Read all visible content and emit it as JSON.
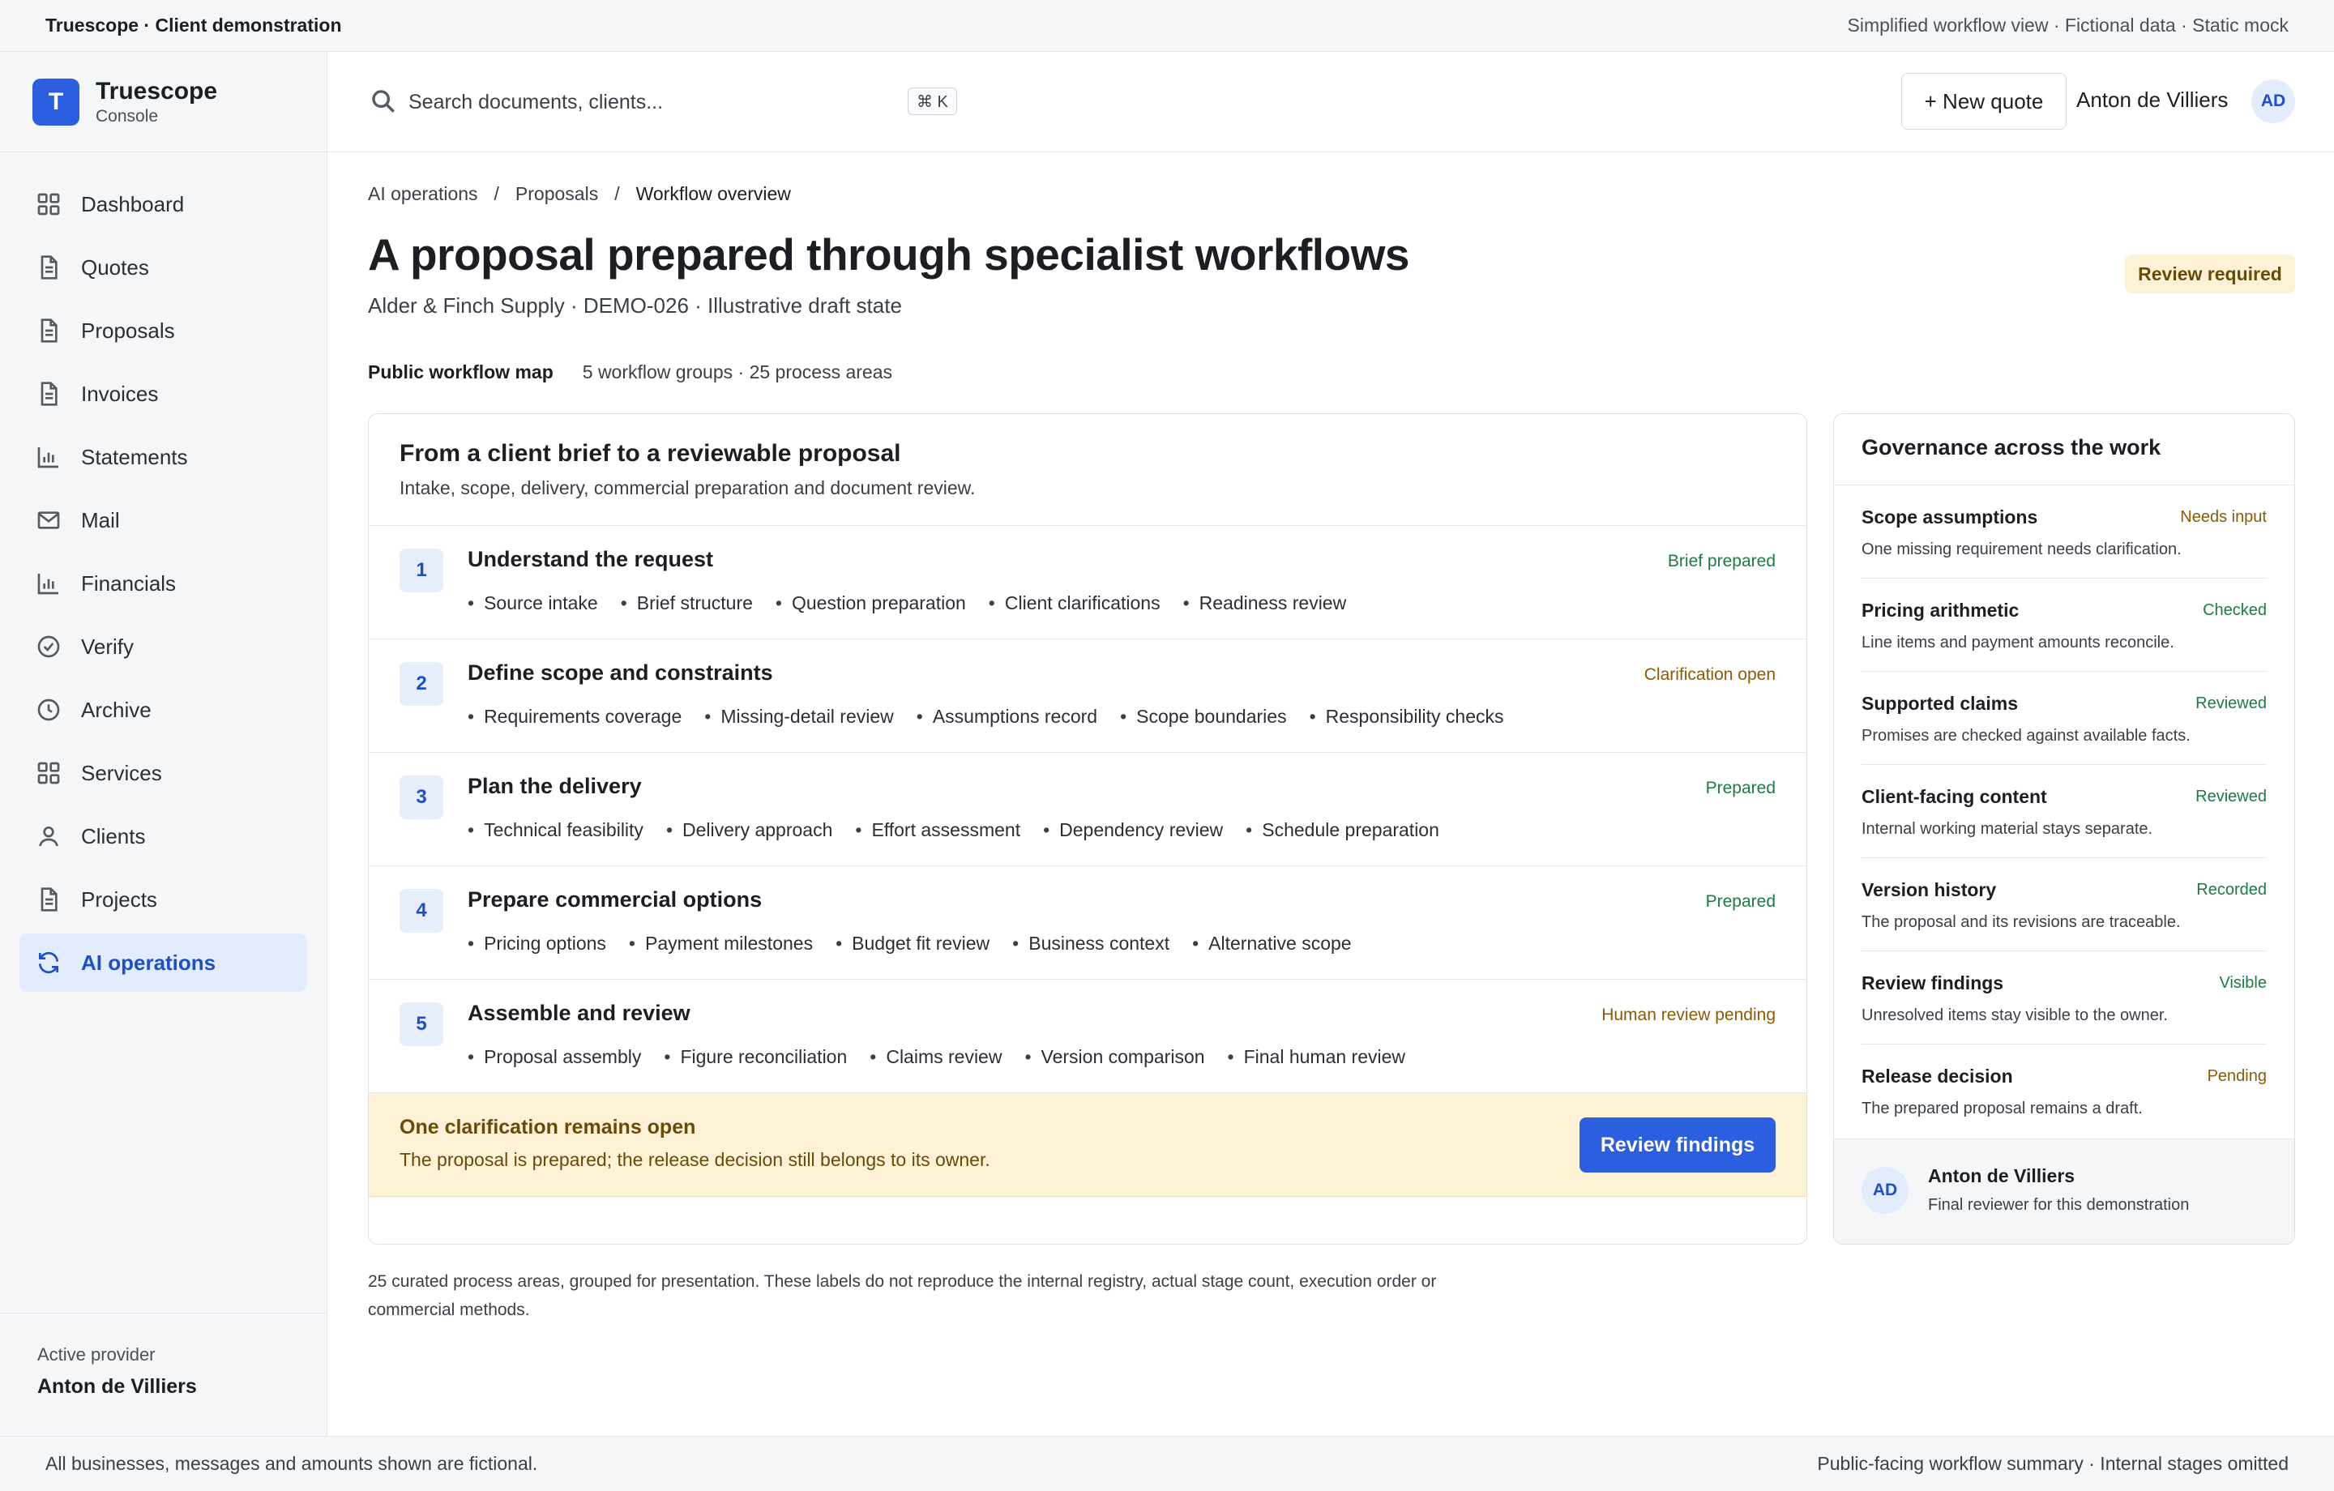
{
  "topbar": {
    "left": "Truescope · Client demonstration",
    "right": "Simplified workflow view · Fictional data · Static mock"
  },
  "sidebar": {
    "brand": {
      "logo": "T",
      "name": "Truescope",
      "sub": "Console"
    },
    "items": [
      {
        "label": "Dashboard",
        "icon": "grid-icon"
      },
      {
        "label": "Quotes",
        "icon": "document-icon"
      },
      {
        "label": "Proposals",
        "icon": "document-icon"
      },
      {
        "label": "Invoices",
        "icon": "document-icon"
      },
      {
        "label": "Statements",
        "icon": "bar-chart-icon"
      },
      {
        "label": "Mail",
        "icon": "mail-icon"
      },
      {
        "label": "Financials",
        "icon": "bar-chart-icon"
      },
      {
        "label": "Verify",
        "icon": "check-circle-icon"
      },
      {
        "label": "Archive",
        "icon": "clock-icon"
      },
      {
        "label": "Services",
        "icon": "grid-icon"
      },
      {
        "label": "Clients",
        "icon": "user-icon"
      },
      {
        "label": "Projects",
        "icon": "document-icon"
      },
      {
        "label": "AI operations",
        "icon": "refresh-icon",
        "active": true
      }
    ],
    "footer": {
      "label": "Active provider",
      "value": "Anton de Villiers"
    }
  },
  "header": {
    "search_placeholder": "Search documents, clients...",
    "shortcut": "⌘ K",
    "new_quote": "+ New quote",
    "user_name": "Anton de Villiers",
    "user_initials": "AD"
  },
  "main": {
    "breadcrumb": [
      "AI operations",
      "/",
      "Proposals",
      "/",
      "Workflow overview"
    ],
    "title": "A proposal prepared through specialist workflows",
    "subtitle": "Alder & Finch Supply · DEMO-026 · Illustrative draft state",
    "badge": "Review required",
    "map_label": "Public workflow map",
    "map_info": "5 workflow groups · 25 process areas",
    "workflow": {
      "title": "From a client brief to a reviewable proposal",
      "description": "Intake, scope, delivery, commercial preparation and document review.",
      "steps": [
        {
          "num": "1",
          "title": "Understand the request",
          "status": "Brief prepared",
          "tone": "green",
          "tags": [
            "Source intake",
            "Brief structure",
            "Question preparation",
            "Client clarifications",
            "Readiness review"
          ]
        },
        {
          "num": "2",
          "title": "Define scope and constraints",
          "status": "Clarification open",
          "tone": "amber",
          "tags": [
            "Requirements coverage",
            "Missing-detail review",
            "Assumptions record",
            "Scope boundaries",
            "Responsibility checks"
          ]
        },
        {
          "num": "3",
          "title": "Plan the delivery",
          "status": "Prepared",
          "tone": "green",
          "tags": [
            "Technical feasibility",
            "Delivery approach",
            "Effort assessment",
            "Dependency review",
            "Schedule preparation"
          ]
        },
        {
          "num": "4",
          "title": "Prepare commercial options",
          "status": "Prepared",
          "tone": "green",
          "tags": [
            "Pricing options",
            "Payment milestones",
            "Budget fit review",
            "Business context",
            "Alternative scope"
          ]
        },
        {
          "num": "5",
          "title": "Assemble and review",
          "status": "Human review pending",
          "tone": "amber",
          "tags": [
            "Proposal assembly",
            "Figure reconciliation",
            "Claims review",
            "Version comparison",
            "Final human review"
          ]
        }
      ],
      "alert": {
        "title": "One clarification remains open",
        "text": "The proposal is prepared; the release decision still belongs to its owner.",
        "button": "Review findings"
      }
    },
    "footnote": "25 curated process areas, grouped for presentation. These labels do not reproduce the internal registry, actual stage count, execution order or commercial methods."
  },
  "governance": {
    "title": "Governance across the work",
    "items": [
      {
        "title": "Scope assumptions",
        "status": "Needs input",
        "tone": "amber",
        "desc": "One missing requirement needs clarification."
      },
      {
        "title": "Pricing arithmetic",
        "status": "Checked",
        "tone": "green",
        "desc": "Line items and payment amounts reconcile."
      },
      {
        "title": "Supported claims",
        "status": "Reviewed",
        "tone": "green",
        "desc": "Promises are checked against available facts."
      },
      {
        "title": "Client-facing content",
        "status": "Reviewed",
        "tone": "green",
        "desc": "Internal working material stays separate."
      },
      {
        "title": "Version history",
        "status": "Recorded",
        "tone": "green",
        "desc": "The proposal and its revisions are traceable."
      },
      {
        "title": "Review findings",
        "status": "Visible",
        "tone": "green",
        "desc": "Unresolved items stay visible to the owner."
      },
      {
        "title": "Release decision",
        "status": "Pending",
        "tone": "amber",
        "desc": "The prepared proposal remains a draft."
      }
    ],
    "reviewer": {
      "initials": "AD",
      "name": "Anton de Villiers",
      "role": "Final reviewer for this demonstration"
    }
  },
  "bottombar": {
    "left": "All businesses, messages and amounts shown are fictional.",
    "right": "Public-facing workflow summary · Internal stages omitted"
  }
}
